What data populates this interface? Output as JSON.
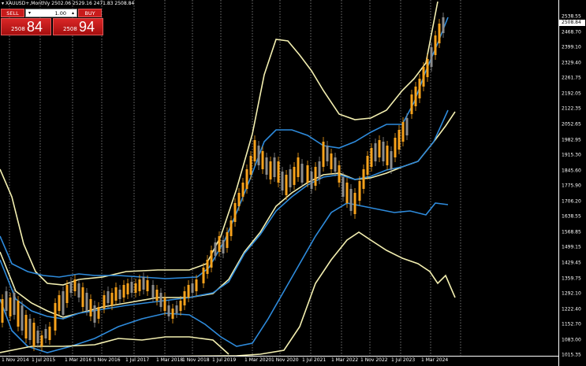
{
  "header": {
    "symbol": "XAUUSD+,Monthly",
    "ohlc": "2502.06 2529.16 2471.83 2508.84"
  },
  "trade_panel": {
    "sell_label": "SELL",
    "buy_label": "BUY",
    "lot_value": "1.00",
    "lot_down_icon": "▾",
    "lot_up_icon": "▴",
    "sell_price_small": "2508",
    "sell_price_big": "84",
    "buy_price_small": "2508",
    "buy_price_big": "94"
  },
  "current_price": "2508.84",
  "colors": {
    "background": "#000000",
    "bull_candle": "#f7a21b",
    "bear_candle": "#8c8c8c",
    "inner_band": "#2e8bdc",
    "outer_band": "#f3efb0",
    "trade_red": "#c81b1b"
  },
  "price_axis": {
    "labels": [
      "2538.55",
      "2468.70",
      "2399.10",
      "2329.40",
      "2261.75",
      "2192.05",
      "2122.35",
      "2052.65",
      "1982.95",
      "1915.30",
      "1845.60",
      "1775.90",
      "1706.20",
      "1638.55",
      "1568.85",
      "1499.15",
      "1429.45",
      "1359.75",
      "1292.10",
      "1222.40",
      "1152.70",
      "1083.00",
      "1015.35"
    ],
    "min": 1015.35,
    "max": 2538.55
  },
  "time_axis": {
    "labels": [
      "1 Nov 2014",
      "1 Jul 2015",
      "1 Mar 2016",
      "1 Nov 2016",
      "1 Jul 2017",
      "1 Mar 2018",
      "1 Nov 2018",
      "1 Jul 2019",
      "1 Mar 2020",
      "1 Nov 2020",
      "1 Jul 2021",
      "1 Mar 2022",
      "1 Nov 2022",
      "1 Jul 2023",
      "1 Mar 2024"
    ]
  }
}
